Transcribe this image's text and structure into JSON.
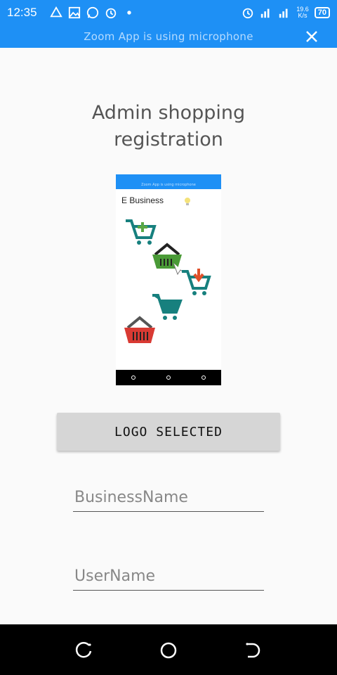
{
  "status_bar": {
    "time": "12:35",
    "network_speed_value": "19.6",
    "network_speed_unit": "K/s",
    "battery": "70"
  },
  "notification": {
    "text": "Zoom App is using microphone"
  },
  "page": {
    "title_line1": "Admin shopping",
    "title_line2": "registration"
  },
  "logo_preview": {
    "notif_text": "Zoom App is using microphone",
    "app_title": "E Business"
  },
  "actions": {
    "logo_button_label": "LOGO SELECTED"
  },
  "form": {
    "business_name_placeholder": "BusinessName",
    "username_placeholder": "UserName"
  },
  "colors": {
    "status_bar": "#1e90f5",
    "background": "#fafafa",
    "button": "#d6d6d6"
  }
}
